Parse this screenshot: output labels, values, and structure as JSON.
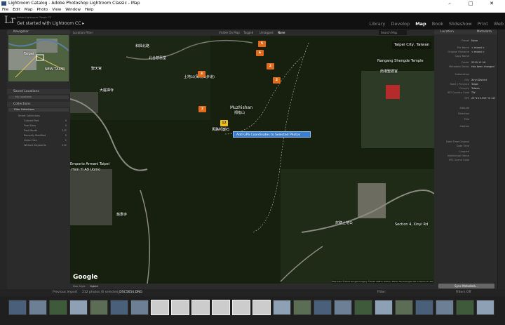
{
  "window": {
    "title": "Lightroom Catalog - Adobe Photoshop Lightroom Classic - Map",
    "controls": [
      "–",
      "□",
      "✕"
    ]
  },
  "menu": [
    "File",
    "Edit",
    "Map",
    "Photo",
    "View",
    "Window",
    "Help"
  ],
  "identity": {
    "logo": "Lr",
    "subtitle": "Adobe Lightroom Classic CC",
    "tagline": "Get started with Lightroom CC ▸"
  },
  "modules": [
    "Library",
    "Develop",
    "Map",
    "Book",
    "Slideshow",
    "Print",
    "Web"
  ],
  "active_module": "Map",
  "left_panel": {
    "navigator": "Navigator",
    "navigator_labels": [
      "Taipei",
      "NEW TAIPEI"
    ],
    "saved_locations": "Saved Locations",
    "my_locations": "My Locations",
    "collections": "Collections",
    "filter_collections": "Filter Collections",
    "smart_collections": "Smart Collections",
    "items": [
      {
        "label": "Colored Red",
        "count": "0"
      },
      {
        "label": "Five Stars",
        "count": "0"
      },
      {
        "label": "Past Month",
        "count": "212"
      },
      {
        "label": "Recently Modified",
        "count": "0"
      },
      {
        "label": "Video Files",
        "count": "1"
      },
      {
        "label": "Without Keywords",
        "count": "212"
      }
    ]
  },
  "map_filter": {
    "label": "Location Filter",
    "options": [
      "Visible On Map",
      "Tagged",
      "Untagged",
      "None"
    ],
    "search": "Search Map"
  },
  "map": {
    "city_box": "Taipei City, Taiwan",
    "context_menu": "Add GPS Coordinates to Selected Photos",
    "google": "Google",
    "credit": "Map data ©2019 Google Imagery ©2019 CNES / Airbus, Maxar Technologies   50 m   Terms of Use",
    "labels": [
      {
        "text": "和興北路",
        "cls": ""
      },
      {
        "text": "北台慈惠堂",
        "cls": ""
      },
      {
        "text": "聖天宮",
        "cls": ""
      },
      {
        "text": "土地公(萬坑山步道)",
        "cls": ""
      },
      {
        "text": "大麗禪寺",
        "cls": ""
      },
      {
        "text": "Nangang Shengde Temple",
        "cls": ""
      },
      {
        "text": "南港聖德宮",
        "cls": ""
      },
      {
        "text": "Muzhishan",
        "cls": "big"
      },
      {
        "text": "拇指山",
        "cls": ""
      },
      {
        "text": "馬路邦巖石",
        "cls": ""
      },
      {
        "text": "Emporio Armani Taipei",
        "cls": ""
      },
      {
        "text": "Hsin Yi A9 Uomo",
        "cls": ""
      },
      {
        "text": "慈惠寺",
        "cls": ""
      },
      {
        "text": "炊膳土地公",
        "cls": ""
      },
      {
        "text": "Section 4, Xinyi Rd",
        "cls": ""
      }
    ],
    "pins": [
      {
        "label": "5",
        "color": "orange"
      },
      {
        "label": "6",
        "color": "orange"
      },
      {
        "label": "2",
        "color": "orange"
      },
      {
        "label": "3",
        "color": "orange"
      },
      {
        "label": "2",
        "color": "orange"
      },
      {
        "label": "2",
        "color": "orange"
      },
      {
        "label": "12",
        "color": "yellow"
      }
    ]
  },
  "map_toolbar": {
    "map_style_label": "Map Style:",
    "map_style": "Hybrid"
  },
  "right_panel": {
    "tabs": [
      "Location",
      "Metadata"
    ],
    "fields": [
      {
        "label": "Preset",
        "value": "None"
      },
      {
        "label": "File Name",
        "value": "< mixed >"
      },
      {
        "label": "Original Filename",
        "value": "< mixed >"
      },
      {
        "label": "Copy Name",
        "value": ""
      },
      {
        "label": "Folder",
        "value": "2019-11-16"
      },
      {
        "label": "Metadata Status",
        "value": "Has been changed"
      },
      {
        "label": "Sublocation",
        "value": ""
      },
      {
        "label": "City",
        "value": "Xinyi District"
      },
      {
        "label": "State / Province",
        "value": "Taipei"
      },
      {
        "label": "Country",
        "value": "Taiwan"
      },
      {
        "label": "ISO Country Code",
        "value": "TW"
      },
      {
        "label": "GPS",
        "value": "25°1'13.555\" N 121°35'1.343\" E"
      },
      {
        "label": "Altitude",
        "value": ""
      },
      {
        "label": "Direction",
        "value": ""
      },
      {
        "label": "Title",
        "value": ""
      },
      {
        "label": "Caption",
        "value": ""
      },
      {
        "label": "Date Time Original",
        "value": ""
      },
      {
        "label": "Date Time",
        "value": ""
      },
      {
        "label": "Cropped",
        "value": ""
      },
      {
        "label": "Intellectual Genre",
        "value": ""
      },
      {
        "label": "IPTC Scene Code",
        "value": ""
      }
    ],
    "sync_button": "Sync Metadata..."
  },
  "filmstrip": {
    "nav": "Previous Import",
    "count": "212 photos /6 selected",
    "file": "_DSC5654.DNG",
    "filter_label": "Filter:",
    "filters_off": "Filters Off",
    "thumb_count": 24,
    "selected_range": [
      7,
      12
    ]
  }
}
